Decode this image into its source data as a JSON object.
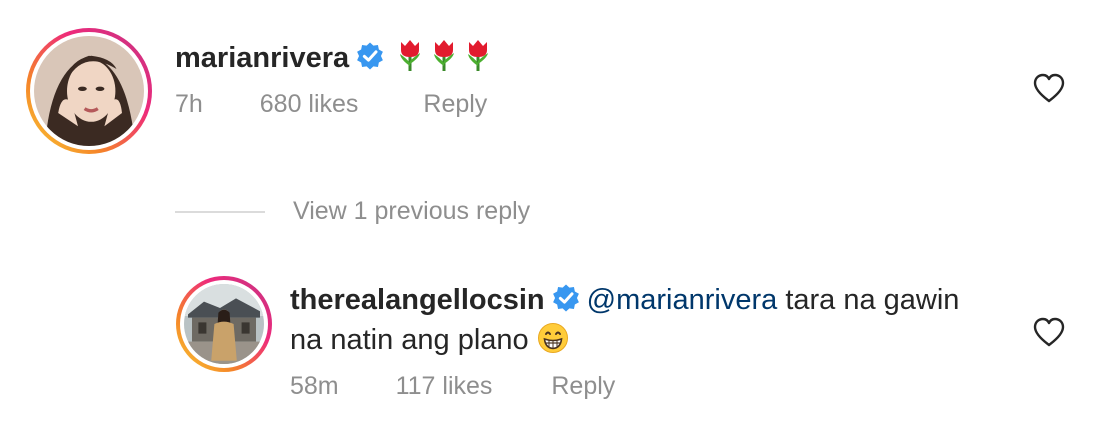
{
  "comments": [
    {
      "username": "marianrivera",
      "verified": true,
      "mention": "",
      "text": "",
      "emoji": [
        "tulip",
        "tulip",
        "tulip"
      ],
      "time": "7h",
      "likes": "680 likes",
      "reply_label": "Reply",
      "avatar_icon": "profile-photo-marianrivera"
    },
    {
      "username": "therealangellocsin",
      "verified": true,
      "mention": "@marianrivera",
      "text_line1": " tara na gawin",
      "text_line2": "na natin ang plano",
      "emoji": [
        "grinning-face"
      ],
      "time": "58m",
      "likes": "117 likes",
      "reply_label": "Reply",
      "avatar_icon": "profile-photo-therealangellocsin"
    }
  ],
  "view_replies": {
    "label": "View 1 previous reply"
  },
  "colors": {
    "text": "#262626",
    "meta": "#8e8e8e",
    "mention": "#00376b",
    "verified": "#3897f0",
    "ring_gradient": [
      "#f9ce34",
      "#ee2a7b",
      "#c13584"
    ]
  }
}
